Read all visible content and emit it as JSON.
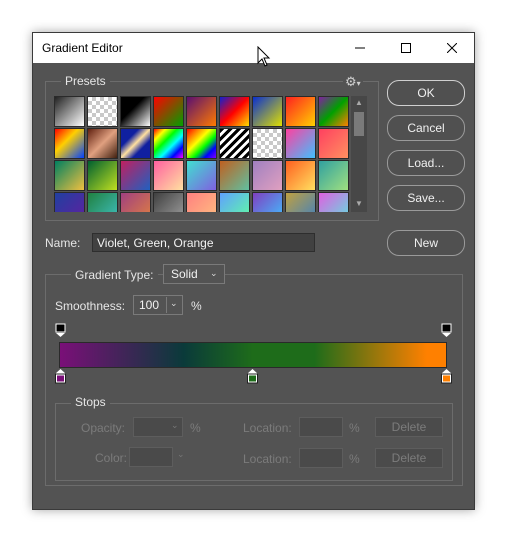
{
  "window": {
    "title": "Gradient Editor"
  },
  "presets": {
    "label": "Presets",
    "gear_icon": "gear-icon"
  },
  "buttons": {
    "ok": "OK",
    "cancel": "Cancel",
    "load": "Load...",
    "save": "Save...",
    "new": "New"
  },
  "name": {
    "label": "Name:",
    "value": "Violet, Green, Orange"
  },
  "gradient_type": {
    "label": "Gradient Type:",
    "value": "Solid"
  },
  "smoothness": {
    "label": "Smoothness:",
    "value": "100",
    "unit": "%"
  },
  "gradient": {
    "colors": [
      "#7a0f78",
      "#0a3a3a",
      "#1e6c1a",
      "#ff8000"
    ]
  },
  "stops": {
    "label": "Stops",
    "opacity_label": "Opacity:",
    "percent": "%",
    "location_label": "Location:",
    "delete_label": "Delete",
    "color_label": "Color:"
  },
  "swatches": [
    "linear-gradient(135deg,#222 0%,#fff 100%)",
    "checker",
    "linear-gradient(135deg,#000 40%,#fff 100%)",
    "linear-gradient(135deg,#ff0000 0%,#00a000 100%)",
    "linear-gradient(135deg,#5a1070 0%,#ff7a00 100%)",
    "linear-gradient(135deg,#1020d0 0%,#ff0000 50%,#ffe000 100%)",
    "linear-gradient(135deg,#0a30d0 0%,#e0e000 100%)",
    "linear-gradient(135deg,#ff2020 0%,#ffd000 100%)",
    "linear-gradient(135deg,#8020a0 0%,#00a000 50%,#ff8000 100%)",
    "linear-gradient(135deg,#ff0000 0%,#ffd000 40%,#0040ff 100%)",
    "linear-gradient(135deg,#602010 0%,#e0a080 50%,#402010 100%)",
    "linear-gradient(135deg,#1020a0 30%,#ffe0a0 50%,#1020a0 70%)",
    "linear-gradient(135deg,#ff0000,#ffff00,#00ff00,#00ffff,#0000ff,#ff00ff)",
    "linear-gradient(135deg,#ff0000,#ff8000,#ffff00,#00ff00,#0000ff,#8000ff)",
    "repeating-linear-gradient(135deg,#000 0 3px,#fff 3px 6px)",
    "checker",
    "linear-gradient(135deg,#ff40a0 0%,#40c0ff 100%)",
    "linear-gradient(135deg,#ff4060 0%,#ff9060 100%)",
    "linear-gradient(135deg,#008060 0%,#f0c040 100%)",
    "linear-gradient(135deg,#006030 0%,#c0e020 100%)",
    "linear-gradient(135deg,#c02060 0%,#2060c0 100%)",
    "linear-gradient(135deg,#ff60a0 0%,#ffe0a0 100%)",
    "linear-gradient(135deg,#40e0d0 0%,#8060e0 100%)",
    "linear-gradient(135deg,#c06020 0%,#60c0a0 100%)",
    "linear-gradient(135deg,#a080c0 0%,#e0a0c0 100%)",
    "linear-gradient(135deg,#ff6020 0%,#ffe060 100%)",
    "linear-gradient(135deg,#30a0a0 0%,#a0e080 100%)",
    "linear-gradient(135deg,#2040a0 0%,#6020a0 100%)",
    "linear-gradient(135deg,#208040 0%,#40c0c0 100%)",
    "linear-gradient(135deg,#a04080 0%,#e08040 100%)",
    "linear-gradient(135deg,#404040 0%,#a0a0a0 100%)",
    "linear-gradient(135deg,#ff8080 0%,#ffc080 100%)",
    "linear-gradient(135deg,#60a0ff 0%,#60ffa0 100%)",
    "linear-gradient(135deg,#8040c0 0%,#40c0ff 100%)",
    "linear-gradient(135deg,#c0a040 0%,#4080c0 100%)",
    "linear-gradient(135deg,#e060e0 0%,#60e0e0 100%)"
  ]
}
